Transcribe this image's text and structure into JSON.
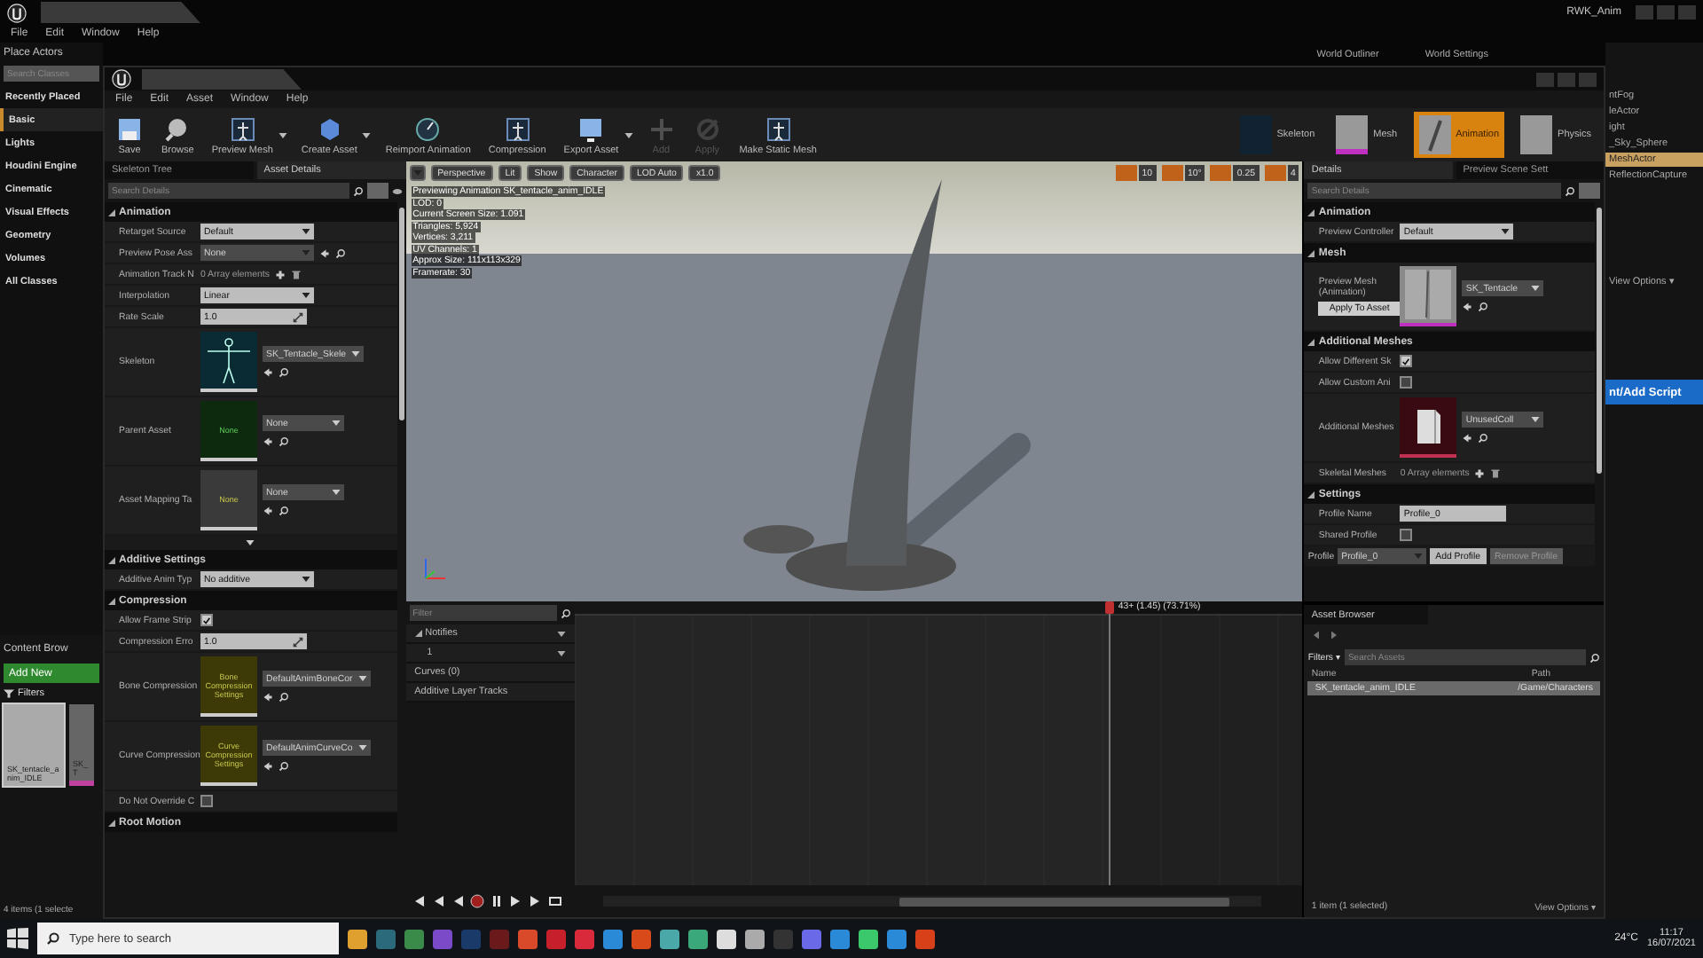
{
  "back_window": {
    "title": "RWK_Anim",
    "menu": [
      "File",
      "Edit",
      "Window",
      "Help"
    ],
    "tabs": [
      {
        "label": "World Outliner"
      },
      {
        "label": "World Settings"
      }
    ]
  },
  "place_actors": {
    "title": "Place Actors",
    "search": {
      "placeholder": "Search Classes"
    },
    "categories": [
      {
        "label": "Recently Placed",
        "selected": false
      },
      {
        "label": "Basic",
        "selected": true
      },
      {
        "label": "Lights",
        "selected": false
      },
      {
        "label": "Houdini Engine",
        "selected": false
      },
      {
        "label": "Cinematic",
        "selected": false
      },
      {
        "label": "Visual Effects",
        "selected": false
      },
      {
        "label": "Geometry",
        "selected": false
      },
      {
        "label": "Volumes",
        "selected": false
      },
      {
        "label": "All Classes",
        "selected": false
      }
    ]
  },
  "content_browser": {
    "title": "Content Brow",
    "add_new": "Add New",
    "filters": "Filters",
    "assets": [
      {
        "name": "SK_tentacle_anim_IDLE",
        "selected": true
      },
      {
        "name": "SK_T",
        "selected": false
      }
    ],
    "status": "4 items (1 selecte"
  },
  "outliner": {
    "items": [
      {
        "label": "ntFog",
        "selected": false
      },
      {
        "label": "leActor",
        "selected": false
      },
      {
        "label": "ight",
        "selected": false
      },
      {
        "label": "_Sky_Sphere",
        "selected": false
      },
      {
        "label": "MeshActor",
        "selected": true
      },
      {
        "label": "ReflectionCapture",
        "selected": false
      }
    ],
    "view_options": "View Options ▾",
    "add_script": "nt/Add Script"
  },
  "editor": {
    "menu": [
      "File",
      "Edit",
      "Asset",
      "Window",
      "Help"
    ],
    "toolbar": [
      {
        "label": "Save",
        "disabled": false,
        "has_dropdown": false
      },
      {
        "label": "Browse",
        "disabled": false,
        "has_dropdown": false
      },
      {
        "label": "Preview Mesh",
        "disabled": false,
        "has_dropdown": true
      },
      {
        "label": "Create Asset",
        "disabled": false,
        "has_dropdown": true
      },
      {
        "label": "Reimport Animation",
        "disabled": false,
        "has_dropdown": false
      },
      {
        "label": "Compression",
        "disabled": false,
        "has_dropdown": false
      },
      {
        "label": "Export Asset",
        "disabled": false,
        "has_dropdown": true
      },
      {
        "label": "Add",
        "disabled": true,
        "has_dropdown": false
      },
      {
        "label": "Apply",
        "disabled": true,
        "has_dropdown": false
      },
      {
        "label": "Make Static Mesh",
        "disabled": false,
        "has_dropdown": false
      }
    ],
    "modes": [
      {
        "label": "Skeleton",
        "selected": false
      },
      {
        "label": "Mesh",
        "selected": false
      },
      {
        "label": "Animation",
        "selected": true
      },
      {
        "label": "Physics",
        "selected": false
      }
    ]
  },
  "asset_details": {
    "tabs": [
      {
        "label": "Skeleton Tree",
        "selected": false
      },
      {
        "label": "Asset Details",
        "selected": true
      }
    ],
    "search": {
      "placeholder": "Search Details"
    },
    "sections": [
      {
        "title": "Animation",
        "rows": [
          {
            "kind": "dropdown",
            "label": "Retarget Source",
            "value": "Default"
          },
          {
            "kind": "picker",
            "label": "Preview Pose Ass",
            "value": "None"
          },
          {
            "kind": "array",
            "label": "Animation Track N",
            "value": "0 Array elements"
          },
          {
            "kind": "dropdown",
            "label": "Interpolation",
            "value": "Linear"
          },
          {
            "kind": "number",
            "label": "Rate Scale",
            "value": "1.0"
          },
          {
            "kind": "skeleton",
            "label": "Skeleton",
            "value": "SK_Tentacle_Skele"
          },
          {
            "kind": "asset",
            "label": "Parent Asset",
            "thumb_label": "None",
            "color": "#0e2a0e",
            "value": "None"
          },
          {
            "kind": "asset",
            "label": "Asset Mapping Ta",
            "thumb_label": "None",
            "color": "#3a3a3a",
            "value": "None"
          }
        ]
      },
      {
        "title": "Additive Settings",
        "rows": [
          {
            "kind": "dropdown",
            "label": "Additive Anim Typ",
            "value": "No additive"
          }
        ]
      },
      {
        "title": "Compression",
        "rows": [
          {
            "kind": "checkbox",
            "label": "Allow Frame Strip",
            "checked": true
          },
          {
            "kind": "number",
            "label": "Compression Erro",
            "value": "1.0"
          },
          {
            "kind": "asset",
            "label": "Bone Compression",
            "thumb_label": "Bone Compression Settings",
            "color": "#3d3a08",
            "value": "DefaultAnimBoneCor"
          },
          {
            "kind": "asset",
            "label": "Curve Compression",
            "thumb_label": "Curve Compression Settings",
            "color": "#3d3a08",
            "value": "DefaultAnimCurveCo"
          },
          {
            "kind": "checkbox",
            "label": "Do Not Override C",
            "checked": false
          }
        ]
      },
      {
        "title": "Root Motion"
      }
    ]
  },
  "viewport": {
    "toolbar": [
      "Perspective",
      "Lit",
      "Show",
      "Character",
      "LOD Auto",
      "x1.0"
    ],
    "snap_values": [
      "10",
      "10°",
      "0.25",
      "4"
    ],
    "info": [
      "Previewing Animation SK_tentacle_anim_IDLE",
      "LOD: 0",
      "Current Screen Size: 1.091",
      "Triangles: 5,924",
      "Vertices: 3,211",
      "UV Channels: 1",
      "Approx Size: 111x113x329",
      "Framerate: 30"
    ]
  },
  "timeline": {
    "filter": {
      "placeholder": "Filter"
    },
    "tracks": [
      {
        "label": "Notifies",
        "children": [
          {
            "label": "1"
          }
        ]
      },
      {
        "label": "Curves (0)"
      },
      {
        "label": "Additive Layer Tracks"
      }
    ],
    "playhead": {
      "label": "43+ (1.45) (73.71%)",
      "level": 0.7371
    }
  },
  "details": {
    "tabs": [
      {
        "label": "Details",
        "selected": true
      },
      {
        "label": "Preview Scene Sett",
        "selected": false
      }
    ],
    "search": {
      "placeholder": "Search Details"
    },
    "sections": [
      {
        "title": "Animation",
        "rows": [
          {
            "kind": "dropdown",
            "label": "Preview Controller",
            "value": "Default"
          }
        ]
      },
      {
        "title": "Mesh",
        "rows": [
          {
            "kind": "mesh",
            "label": "Preview Mesh (Animation)",
            "value": "SK_Tentacle",
            "button": "Apply To Asset"
          }
        ]
      },
      {
        "title": "Additional Meshes",
        "rows": [
          {
            "kind": "checkbox",
            "label": "Allow Different Sk",
            "checked": true
          },
          {
            "kind": "checkbox",
            "label": "Allow Custom Ani",
            "checked": false
          },
          {
            "kind": "meshes",
            "label": "Additional Meshes",
            "value": "UnusedColl"
          },
          {
            "kind": "array",
            "label": "Skeletal Meshes",
            "value": "0 Array elements"
          }
        ]
      },
      {
        "title": "Settings",
        "rows": [
          {
            "kind": "text",
            "label": "Profile Name",
            "value": "Profile_0"
          },
          {
            "kind": "checkbox",
            "label": "Shared Profile",
            "checked": false
          }
        ]
      }
    ],
    "profile_bar": {
      "label": "Profile",
      "value": "Profile_0",
      "buttons": [
        "Add Profile",
        "Remove Profile"
      ]
    }
  },
  "asset_browser": {
    "title": "Asset Browser",
    "filters": "Filters ▾",
    "search": {
      "placeholder": "Search Assets"
    },
    "columns": [
      "Name",
      "Path"
    ],
    "rows": [
      {
        "name": "SK_tentacle_anim_IDLE",
        "path": "/Game/Characters",
        "selected": true
      }
    ],
    "status": "1 item (1 selected)",
    "view_options": "View Options ▾"
  },
  "taskbar": {
    "search": {
      "placeholder": "Type here to search"
    },
    "weather": "24°C",
    "time": "11:17",
    "date": "16/07/2021"
  }
}
